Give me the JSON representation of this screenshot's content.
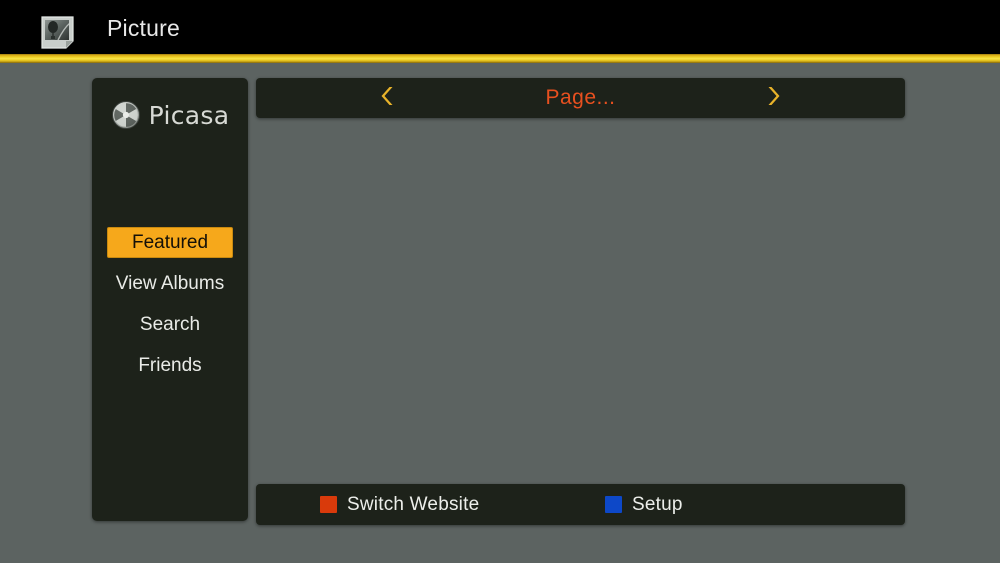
{
  "header": {
    "title": "Picture",
    "icon": "picture-file-icon"
  },
  "accent_color": "#f3d62a",
  "sidebar": {
    "brand": {
      "name": "Picasa",
      "icon": "camera-aperture-icon"
    },
    "items": [
      {
        "label": "Featured",
        "selected": true,
        "name": "sidebar-item-featured"
      },
      {
        "label": "View Albums",
        "selected": false,
        "name": "sidebar-item-view-albums"
      },
      {
        "label": "Search",
        "selected": false,
        "name": "sidebar-item-search"
      },
      {
        "label": "Friends",
        "selected": false,
        "name": "sidebar-item-friends"
      }
    ],
    "selected_bg": "#f6a81b"
  },
  "pager": {
    "label": "Page...",
    "label_color": "#e8501f",
    "prev_icon": "chevron-left-icon",
    "next_icon": "chevron-right-icon",
    "chevron_color": "#e8b32a"
  },
  "content": {
    "items": []
  },
  "actionbar": {
    "actions": [
      {
        "label": "Switch Website",
        "color": "#d93a0b",
        "name": "action-switch-website"
      },
      {
        "label": "Setup",
        "color": "#0d48c8",
        "name": "action-setup"
      }
    ]
  }
}
